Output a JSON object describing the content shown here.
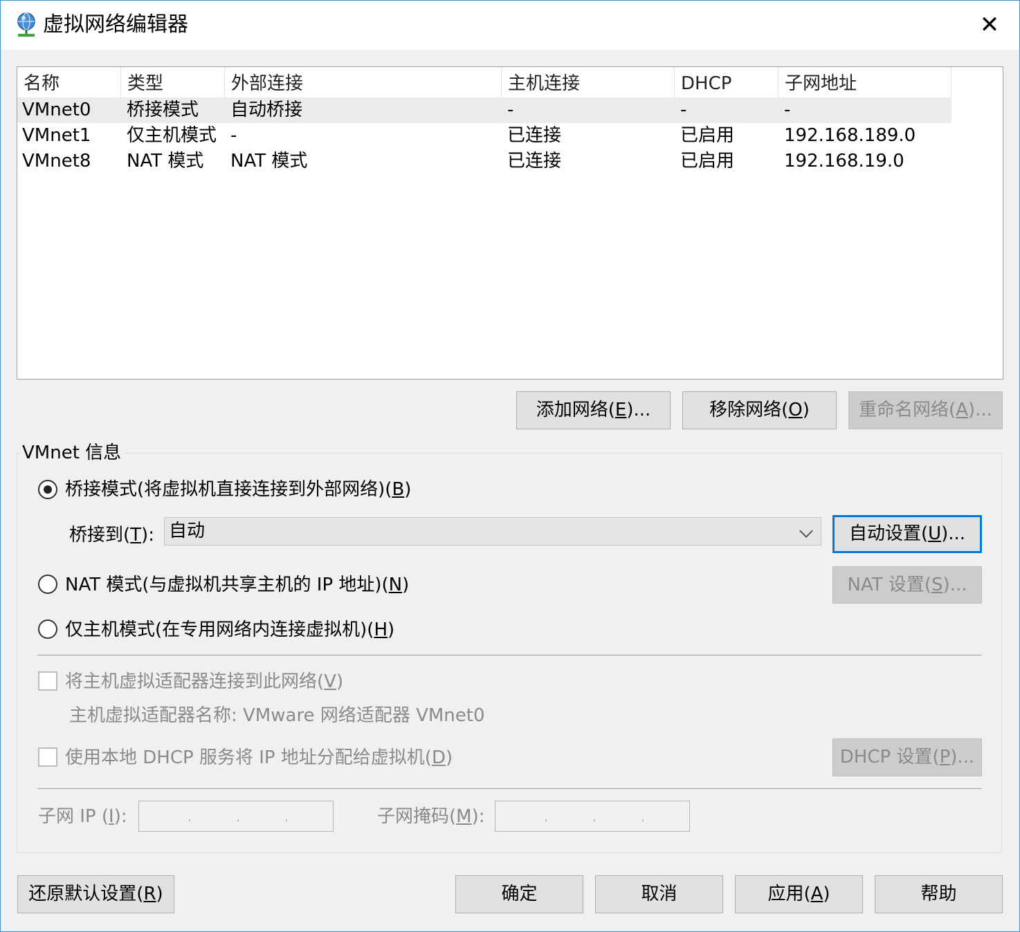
{
  "window": {
    "title": "虚拟网络编辑器",
    "close_glyph": "✕"
  },
  "table": {
    "headers": [
      "名称",
      "类型",
      "外部连接",
      "主机连接",
      "DHCP",
      "子网地址"
    ],
    "rows": [
      {
        "name": "VMnet0",
        "type": "桥接模式",
        "external": "自动桥接",
        "host": "-",
        "dhcp": "-",
        "subnet": "-"
      },
      {
        "name": "VMnet1",
        "type": "仅主机模式",
        "external": "-",
        "host": "已连接",
        "dhcp": "已启用",
        "subnet": "192.168.189.0"
      },
      {
        "name": "VMnet8",
        "type": "NAT 模式",
        "external": "NAT 模式",
        "host": "已连接",
        "dhcp": "已启用",
        "subnet": "192.168.19.0"
      }
    ],
    "selected_row": "VMnet0"
  },
  "network_buttons": {
    "add": {
      "pre": "添加网络(",
      "key": "E",
      "post": ")..."
    },
    "remove": {
      "pre": "移除网络(",
      "key": "O",
      "post": ")"
    },
    "rename": {
      "pre": "重命名网络(",
      "key": "A",
      "post": ")..."
    }
  },
  "vmnet_info": {
    "group_label": "VMnet 信息",
    "bridged": {
      "pre": "桥接模式(将虚拟机直接连接到外部网络)(",
      "key": "B",
      "post": ")",
      "checked": true
    },
    "bridge_to": {
      "pre": "桥接到(",
      "key": "T",
      "post": "):",
      "value": "自动"
    },
    "auto_settings": {
      "pre": "自动设置(",
      "key": "U",
      "post": ")..."
    },
    "nat": {
      "pre": "NAT 模式(与虚拟机共享主机的 IP 地址)(",
      "key": "N",
      "post": ")",
      "checked": false
    },
    "nat_settings": {
      "pre": "NAT 设置(",
      "key": "S",
      "post": ")..."
    },
    "host_only": {
      "pre": "仅主机模式(在专用网络内连接虚拟机)(",
      "key": "H",
      "post": ")",
      "checked": false
    },
    "connect_adapter": {
      "pre": "将主机虚拟适配器连接到此网络(",
      "key": "V",
      "post": ")",
      "checked": false
    },
    "adapter_name": "主机虚拟适配器名称: VMware 网络适配器 VMnet0",
    "use_dhcp": {
      "pre": "使用本地 DHCP 服务将 IP 地址分配给虚拟机(",
      "key": "D",
      "post": ")",
      "checked": false
    },
    "dhcp_settings": {
      "pre": "DHCP 设置(",
      "key": "P",
      "post": ")..."
    },
    "subnet_ip": {
      "pre": "子网 IP (",
      "key": "I",
      "post": "):"
    },
    "subnet_mask": {
      "pre": "子网掩码(",
      "key": "M",
      "post": "):"
    }
  },
  "footer": {
    "restore": {
      "pre": "还原默认设置(",
      "key": "R",
      "post": ")"
    },
    "ok": "确定",
    "cancel": "取消",
    "apply": {
      "pre": "应用(",
      "key": "A",
      "post": ")"
    },
    "help": "帮助"
  },
  "colors": {
    "window_bg": "#f0f0f0",
    "selection": "#ebebeb",
    "focus_accent": "#0078d7",
    "disabled_text": "#8a8a8a"
  },
  "icons": [
    "network-globe-icon",
    "close-icon",
    "chevron-down-icon"
  ]
}
